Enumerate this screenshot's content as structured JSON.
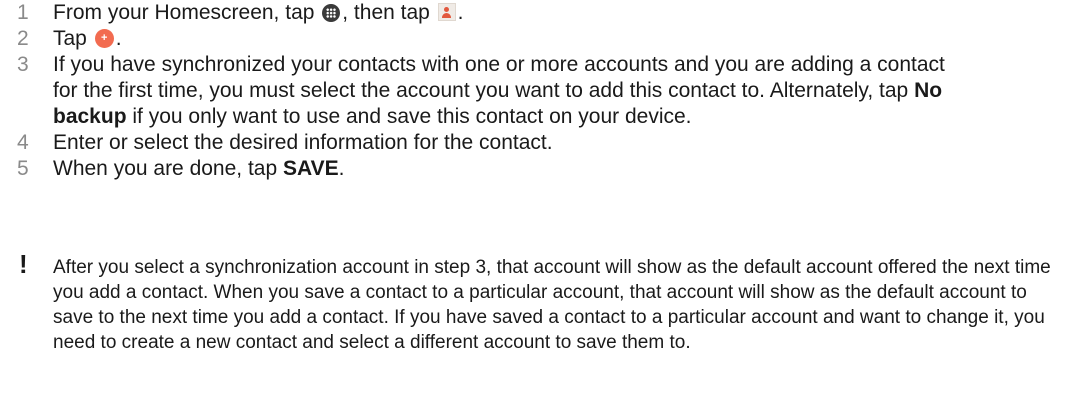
{
  "steps": [
    {
      "number": "1",
      "text_a": "From your Homescreen, tap ",
      "text_b": ", then tap ",
      "text_c": "."
    },
    {
      "number": "2",
      "text_a": "Tap ",
      "text_b": "."
    },
    {
      "number": "3",
      "text_a": "If you have synchronized your contacts with one or more accounts and you are adding a contact for the first time, you must select the account you want to add this contact to. Alternately, tap ",
      "bold": "No backup",
      "text_b": " if you only want to use and save this contact on your device."
    },
    {
      "number": "4",
      "text_a": "Enter or select the desired information for the contact."
    },
    {
      "number": "5",
      "text_a": "When you are done, tap ",
      "bold": "SAVE",
      "text_b": "."
    }
  ],
  "note": {
    "icon": "!",
    "text": "After you select a synchronization account in step 3, that account will show as the default account offered the next time you add a contact. When you save a contact to a particular account, that account will show as the default account to save to the next time you add a contact. If you have saved a contact to a particular account and want to change it, you need to create a new contact and select a different account to save them to."
  },
  "icons": {
    "apps": "apps-grid-icon",
    "contacts": "contacts-app-icon",
    "add": "add-contact-icon"
  },
  "colors": {
    "step_number": "#8a8a8a",
    "text": "#1a1a1a",
    "add_button": "#f26b50"
  }
}
